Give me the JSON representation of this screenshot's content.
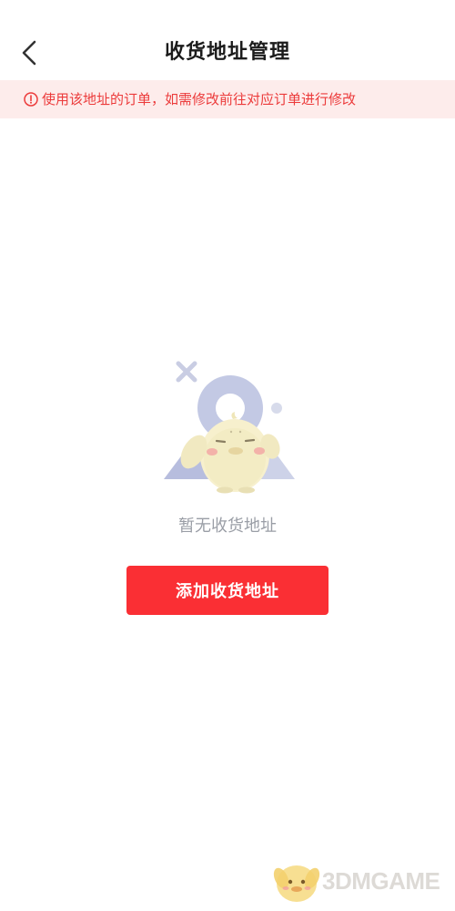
{
  "header": {
    "back_icon": "chevron-left-icon",
    "title": "收货地址管理"
  },
  "notice": {
    "icon": "info-circle-icon",
    "text": "使用该地址的订单，如需修改前往对应订单进行修改",
    "color": "#ec3b3b",
    "background": "#fdeceb"
  },
  "empty_state": {
    "illustration": "empty-address-mascot-illustration",
    "message": "暂无收货地址"
  },
  "actions": {
    "add_address_label": "添加收货地址",
    "accent_color": "#fa2f34"
  },
  "watermark": {
    "text": "3DMGAME"
  }
}
